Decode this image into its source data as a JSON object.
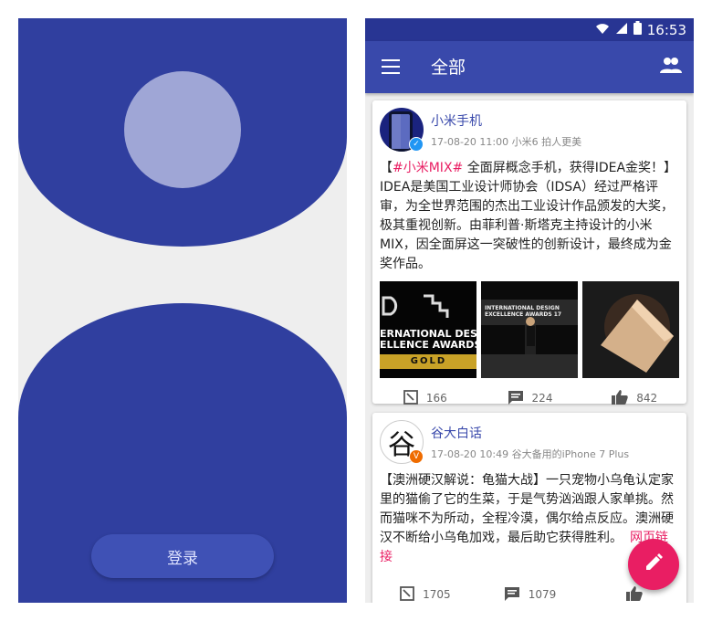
{
  "login": {
    "button_label": "登录"
  },
  "status_bar": {
    "time": "16:53"
  },
  "appbar": {
    "title": "全部"
  },
  "posts": [
    {
      "author": "小米手机",
      "meta": "17-08-20 11:00   小米6 拍人更美",
      "text_tag": "#小米MIX#",
      "text_before": "【",
      "text_body": " 全面屏概念手机，获得IDEA金奖！】IDEA是美国工业设计师协会（IDSA）经过严格评审，为全世界范围的杰出工业设计作品颁发的大奖，极其重视创新。由菲利普·斯塔克主持设计的小米MIX，因全面屏这一突破性的创新设计，最终成为金奖作品。",
      "image1_lines": [
        "ERNATIONAL DES",
        "ELLENCE AWARDS"
      ],
      "image1_badge": "GOLD",
      "image2_lines": [
        "INTERNATIONAL DESIGN",
        "EXCELLENCE AWARDS 17"
      ],
      "reposts": "166",
      "comments": "224",
      "likes": "842"
    },
    {
      "author": "谷大白话",
      "meta": "17-08-20 10:49   谷大备用的iPhone 7 Plus",
      "text_body": "【澳洲硬汉解说：龟猫大战】一只宠物小乌龟认定家里的猫偷了它的生菜，于是气势汹汹跟人家单挑。然而猫咪不为所动，全程冷漠，偶尔给点反应。澳洲硬汉不断给小乌龟加戏，最后助它获得胜利。",
      "link": "网页链接",
      "avatar_glyph": "谷",
      "reposts": "1705",
      "comments": "1079"
    }
  ],
  "colors": {
    "primary": "#3949ab",
    "primary_dark": "#283593",
    "accent": "#e91e63",
    "login_bg": "#303f9f"
  }
}
